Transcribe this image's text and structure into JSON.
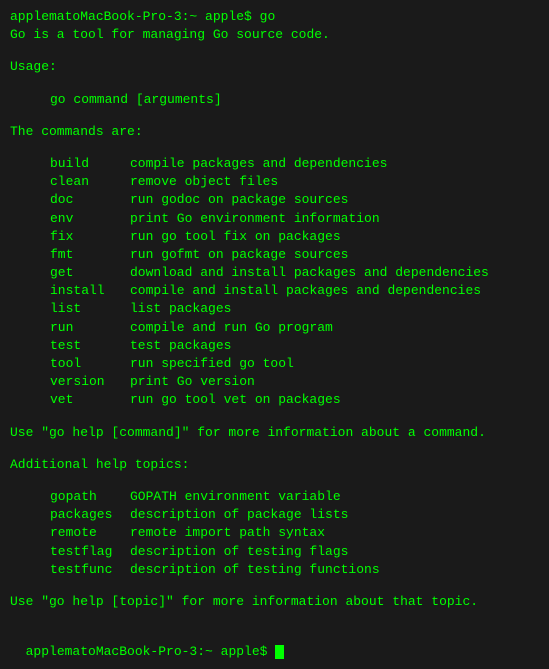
{
  "terminal": {
    "prompt1": "applematoMacBook-Pro-3:~ apple$ go",
    "intro": "Go is a tool for managing Go source code.",
    "usage_label": "Usage:",
    "usage_cmd": "go command [arguments]",
    "commands_label": "The commands are:",
    "commands": [
      {
        "name": "build",
        "desc": "compile packages and dependencies"
      },
      {
        "name": "clean",
        "desc": "remove object files"
      },
      {
        "name": "doc",
        "desc": "run godoc on package sources"
      },
      {
        "name": "env",
        "desc": "print Go environment information"
      },
      {
        "name": "fix",
        "desc": "run go tool fix on packages"
      },
      {
        "name": "fmt",
        "desc": "run gofmt on package sources"
      },
      {
        "name": "get",
        "desc": "download and install packages and dependencies"
      },
      {
        "name": "install",
        "desc": "compile and install packages and dependencies"
      },
      {
        "name": "list",
        "desc": "list packages"
      },
      {
        "name": "run",
        "desc": "compile and run Go program"
      },
      {
        "name": "test",
        "desc": "test packages"
      },
      {
        "name": "tool",
        "desc": "run specified go tool"
      },
      {
        "name": "version",
        "desc": "print Go version"
      },
      {
        "name": "vet",
        "desc": "run go tool vet on packages"
      }
    ],
    "help_cmd_text": "Use \"go help [command]\" for more information about a command.",
    "additional_label": "Additional help topics:",
    "topics": [
      {
        "name": "gopath",
        "desc": "GOPATH environment variable"
      },
      {
        "name": "packages",
        "desc": "description of package lists"
      },
      {
        "name": "remote",
        "desc": "remote import path syntax"
      },
      {
        "name": "testflag",
        "desc": "description of testing flags"
      },
      {
        "name": "testfunc",
        "desc": "description of testing functions"
      }
    ],
    "help_topic_text": "Use \"go help [topic]\" for more information about that topic.",
    "prompt2": "applematoMacBook-Pro-3:~ apple$ "
  }
}
